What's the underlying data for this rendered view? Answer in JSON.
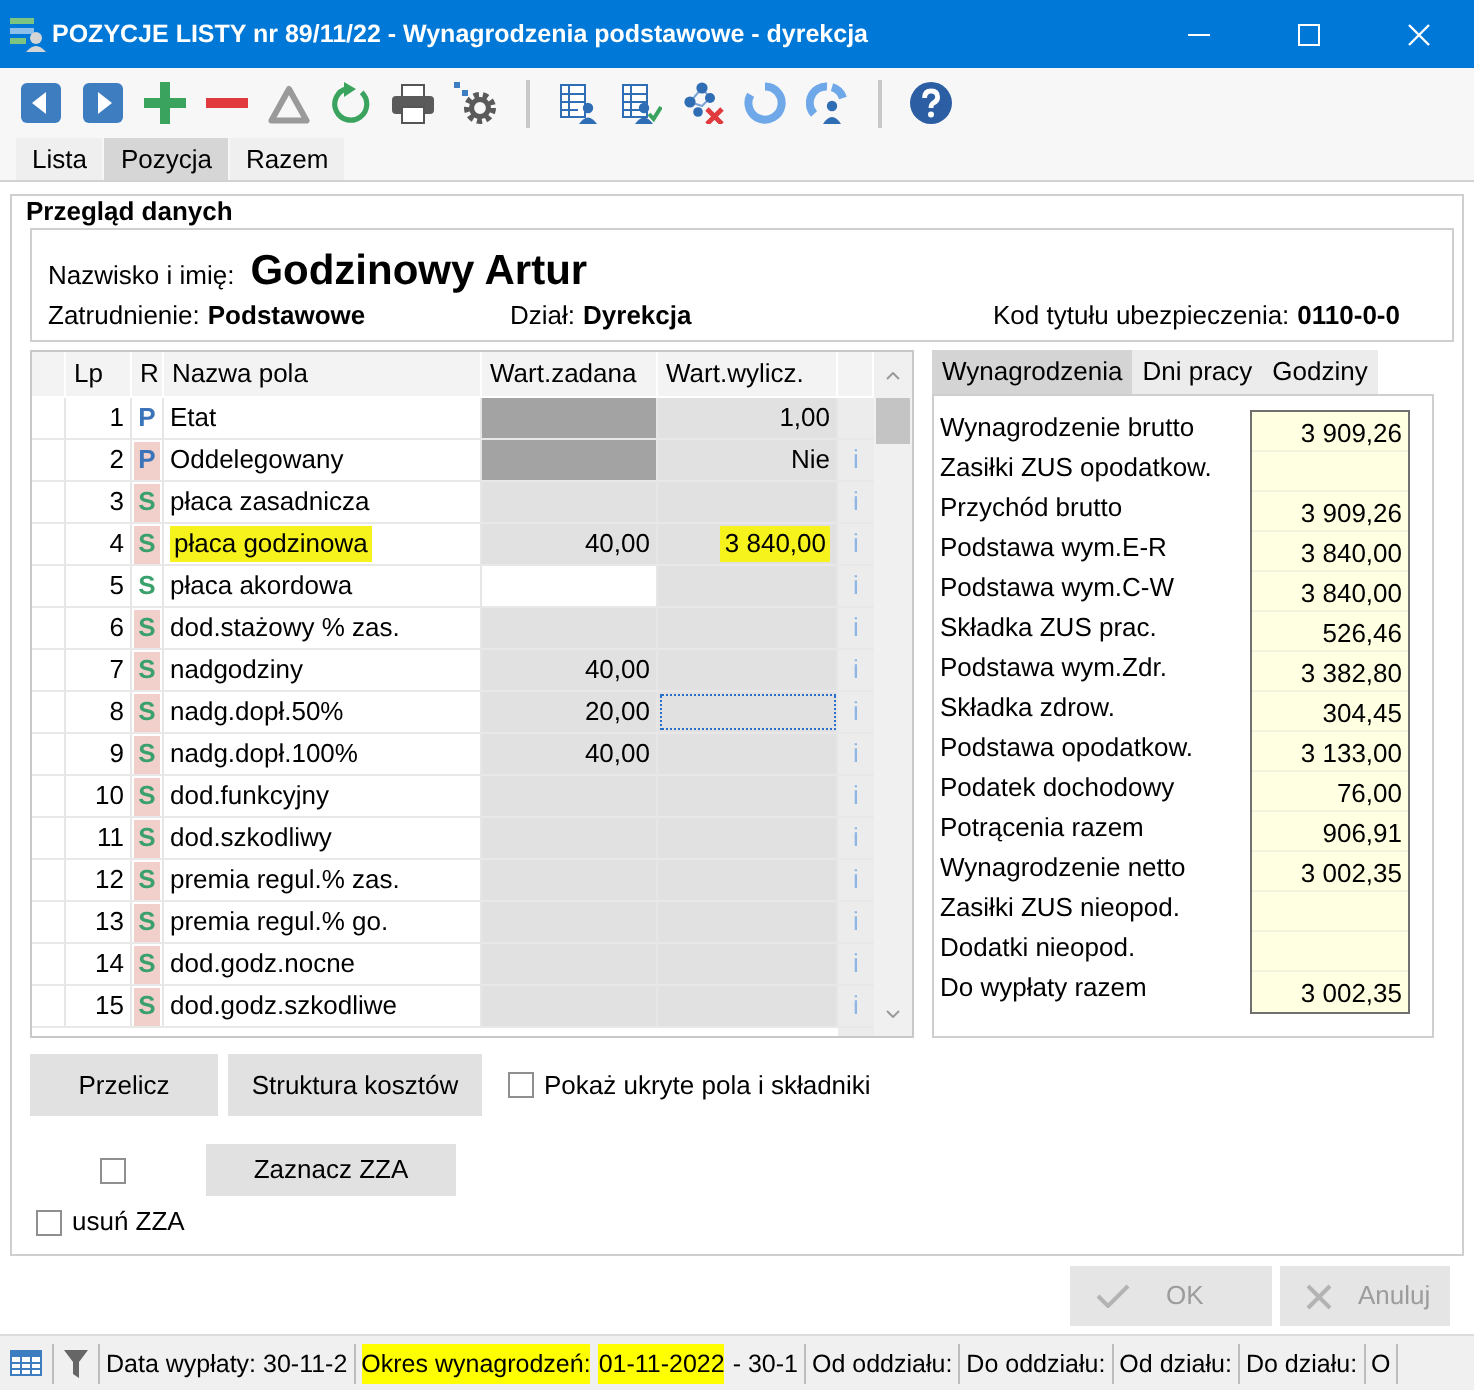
{
  "window": {
    "title": "POZYCJE LISTY nr 89/11/22 - Wynagrodzenia podstawowe - dyrekcja"
  },
  "tabs": [
    {
      "label": "Lista",
      "selected": false
    },
    {
      "label": "Pozycja",
      "selected": true
    },
    {
      "label": "Razem",
      "selected": false
    }
  ],
  "overview": {
    "title": "Przegląd danych",
    "name_label": "Nazwisko i imię:",
    "name": "Godzinowy Artur",
    "fields": [
      {
        "label": "Zatrudnienie:",
        "value": "Podstawowe"
      },
      {
        "label": "Dział:",
        "value": "Dyrekcja"
      },
      {
        "label": "Kod tytułu ubezpieczenia:",
        "value": "0110-0-0"
      }
    ]
  },
  "grid": {
    "columns": [
      "Lp",
      "R",
      "Nazwa pola",
      "Wart.zadana",
      "Wart.wylicz."
    ],
    "rows": [
      {
        "lp": "1",
        "type": {
          "letter": "P",
          "kind": "parameter",
          "marked": false
        },
        "name": "Etat",
        "name_highlighted": false,
        "set": {
          "kind": "blocked"
        },
        "computed": {
          "text": "1,00",
          "highlighted": false
        },
        "focused": false
      },
      {
        "lp": "2",
        "type": {
          "letter": "P",
          "kind": "parameter",
          "marked": true
        },
        "name": "Oddelegowany",
        "name_highlighted": false,
        "set": {
          "kind": "blocked"
        },
        "computed": {
          "text": "Nie",
          "highlighted": false
        },
        "focused": false,
        "info": "i"
      },
      {
        "lp": "3",
        "type": {
          "letter": "S",
          "kind": "component",
          "marked": true
        },
        "name": "płaca zasadnicza",
        "name_highlighted": false,
        "set": {
          "kind": "readonly"
        },
        "focused": false,
        "info": "i"
      },
      {
        "lp": "4",
        "type": {
          "letter": "S",
          "kind": "component",
          "marked": true
        },
        "name": "płaca godzinowa",
        "name_highlighted": true,
        "set": {
          "kind": "readonly",
          "value": "40,00"
        },
        "computed": {
          "text": "3 840,00",
          "highlighted": true
        },
        "focused": false,
        "info": "i"
      },
      {
        "lp": "5",
        "type": {
          "letter": "S",
          "kind": "component",
          "marked": false
        },
        "name": "płaca akordowa",
        "name_highlighted": false,
        "set": {
          "kind": "editable"
        },
        "focused": false,
        "info": "i"
      },
      {
        "lp": "6",
        "type": {
          "letter": "S",
          "kind": "component",
          "marked": true
        },
        "name": "dod.stażowy % zas.",
        "name_highlighted": false,
        "set": {
          "kind": "readonly"
        },
        "focused": false,
        "info": "i"
      },
      {
        "lp": "7",
        "type": {
          "letter": "S",
          "kind": "component",
          "marked": true
        },
        "name": "nadgodziny",
        "name_highlighted": false,
        "set": {
          "kind": "readonly",
          "value": "40,00"
        },
        "focused": false,
        "info": "i"
      },
      {
        "lp": "8",
        "type": {
          "letter": "S",
          "kind": "component",
          "marked": true
        },
        "name": "nadg.dopł.50%",
        "name_highlighted": false,
        "set": {
          "kind": "readonly",
          "value": "20,00"
        },
        "focused": true,
        "info": "i"
      },
      {
        "lp": "9",
        "type": {
          "letter": "S",
          "kind": "component",
          "marked": true
        },
        "name": "nadg.dopł.100%",
        "name_highlighted": false,
        "set": {
          "kind": "readonly",
          "value": "40,00"
        },
        "focused": false,
        "info": "i"
      },
      {
        "lp": "10",
        "type": {
          "letter": "S",
          "kind": "component",
          "marked": true
        },
        "name": "dod.funkcyjny",
        "name_highlighted": false,
        "set": {
          "kind": "readonly"
        },
        "focused": false,
        "info": "i"
      },
      {
        "lp": "11",
        "type": {
          "letter": "S",
          "kind": "component",
          "marked": true
        },
        "name": "dod.szkodliwy",
        "name_highlighted": false,
        "set": {
          "kind": "readonly"
        },
        "focused": false,
        "info": "i"
      },
      {
        "lp": "12",
        "type": {
          "letter": "S",
          "kind": "component",
          "marked": true
        },
        "name": "premia regul.% zas.",
        "name_highlighted": false,
        "set": {
          "kind": "readonly"
        },
        "focused": false,
        "info": "i"
      },
      {
        "lp": "13",
        "type": {
          "letter": "S",
          "kind": "component",
          "marked": true
        },
        "name": "premia regul.% go.",
        "name_highlighted": false,
        "set": {
          "kind": "readonly"
        },
        "focused": false,
        "info": "i"
      },
      {
        "lp": "14",
        "type": {
          "letter": "S",
          "kind": "component",
          "marked": true
        },
        "name": "dod.godz.nocne",
        "name_highlighted": false,
        "set": {
          "kind": "readonly"
        },
        "focused": false,
        "info": "i"
      },
      {
        "lp": "15",
        "type": {
          "letter": "S",
          "kind": "component",
          "marked": true
        },
        "name": "dod.godz.szkodliwe",
        "name_highlighted": false,
        "set": {
          "kind": "readonly"
        },
        "focused": false,
        "info": "i"
      }
    ]
  },
  "summary": {
    "tabs": [
      {
        "label": "Wynagrodzenia",
        "selected": true
      },
      {
        "label": "Dni pracy",
        "selected": false
      },
      {
        "label": "Godziny",
        "selected": false
      }
    ],
    "rows": [
      {
        "label": "Wynagrodzenie brutto",
        "value": "3 909,26"
      },
      {
        "label": "Zasiłki ZUS opodatkow."
      },
      {
        "label": "Przychód brutto",
        "value": "3 909,26"
      },
      {
        "label": "Podstawa wym.E-R",
        "value": "3 840,00"
      },
      {
        "label": "Podstawa wym.C-W",
        "value": "3 840,00"
      },
      {
        "label": "Składka ZUS prac.",
        "value": "526,46"
      },
      {
        "label": "Podstawa wym.Zdr.",
        "value": "3 382,80"
      },
      {
        "label": "Składka zdrow.",
        "value": "304,45"
      },
      {
        "label": "Podstawa opodatkow.",
        "value": "3 133,00"
      },
      {
        "label": "Podatek dochodowy",
        "value": "76,00"
      },
      {
        "label": "Potrącenia razem",
        "value": "906,91"
      },
      {
        "label": "Wynagrodzenie netto",
        "value": "3 002,35"
      },
      {
        "label": "Zasiłki ZUS nieopod."
      },
      {
        "label": "Dodatki nieopod."
      },
      {
        "label": "Do wypłaty razem",
        "value": "3 002,35"
      }
    ]
  },
  "controls": {
    "buttons": [
      {
        "label": "Przelicz"
      },
      {
        "label": "Struktura kosztów"
      }
    ],
    "show_hidden": {
      "label": "Pokaż ukryte pola i składniki",
      "checked": false
    },
    "zza_mark": {
      "checked": false
    },
    "zza_button": {
      "label": "Zaznacz ZZA"
    },
    "remove_zza": {
      "label": "usuń ZZA",
      "checked": false
    }
  },
  "dialog_buttons": [
    {
      "kind": "ok",
      "label": "OK",
      "disabled": true
    },
    {
      "kind": "cancel",
      "label": "Anuluj",
      "disabled": true
    }
  ],
  "status_bar": {
    "fields": [
      {
        "parts": [
          {
            "text": "Data wypłaty: 30-11-2",
            "highlighted": false
          }
        ]
      },
      {
        "parts": [
          {
            "text": "Okres wynagrodzeń:",
            "highlighted": true
          },
          {
            "text": "01-11-2022",
            "highlighted": true
          },
          {
            "text": "- 30-1",
            "highlighted": false
          }
        ]
      },
      {
        "parts": [
          {
            "text": "Od oddziału:",
            "highlighted": false
          }
        ]
      },
      {
        "parts": [
          {
            "text": "Do oddziału:",
            "highlighted": false
          }
        ]
      },
      {
        "parts": [
          {
            "text": "Od działu:",
            "highlighted": false
          }
        ]
      },
      {
        "parts": [
          {
            "text": "Do działu:",
            "highlighted": false
          }
        ]
      },
      {
        "parts": [
          {
            "text": "O",
            "highlighted": false
          }
        ]
      }
    ]
  }
}
